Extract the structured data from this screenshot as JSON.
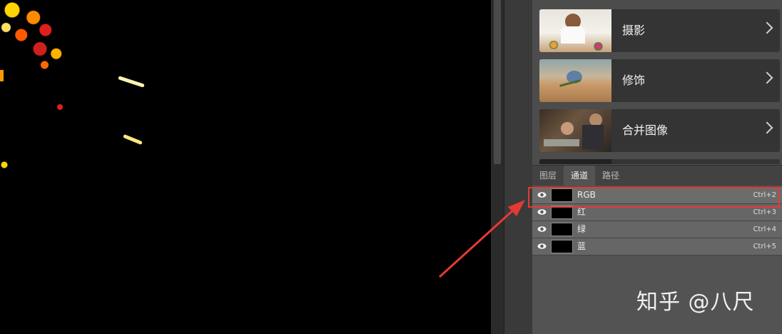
{
  "learn_cards": [
    {
      "title": "摄影",
      "thumb_icon": "photo-flower-woman-thumbnail"
    },
    {
      "title": "修饰",
      "thumb_icon": "photo-flower-table-thumbnail"
    },
    {
      "title": "合并图像",
      "thumb_icon": "photo-workshop-thumbnail"
    }
  ],
  "tabs": [
    {
      "label": "图层",
      "active": false
    },
    {
      "label": "通道",
      "active": true
    },
    {
      "label": "路径",
      "active": false
    }
  ],
  "channels": [
    {
      "name": "RGB",
      "shortcut": "Ctrl+2",
      "selected": true
    },
    {
      "name": "红",
      "shortcut": "Ctrl+3",
      "selected": false
    },
    {
      "name": "绿",
      "shortcut": "Ctrl+4",
      "selected": false
    },
    {
      "name": "蓝",
      "shortcut": "Ctrl+5",
      "selected": false
    }
  ],
  "watermark": "知乎 @八尺",
  "colors": {
    "annotation": "#e53935",
    "panel": "#535353",
    "canvas": "#000000"
  }
}
